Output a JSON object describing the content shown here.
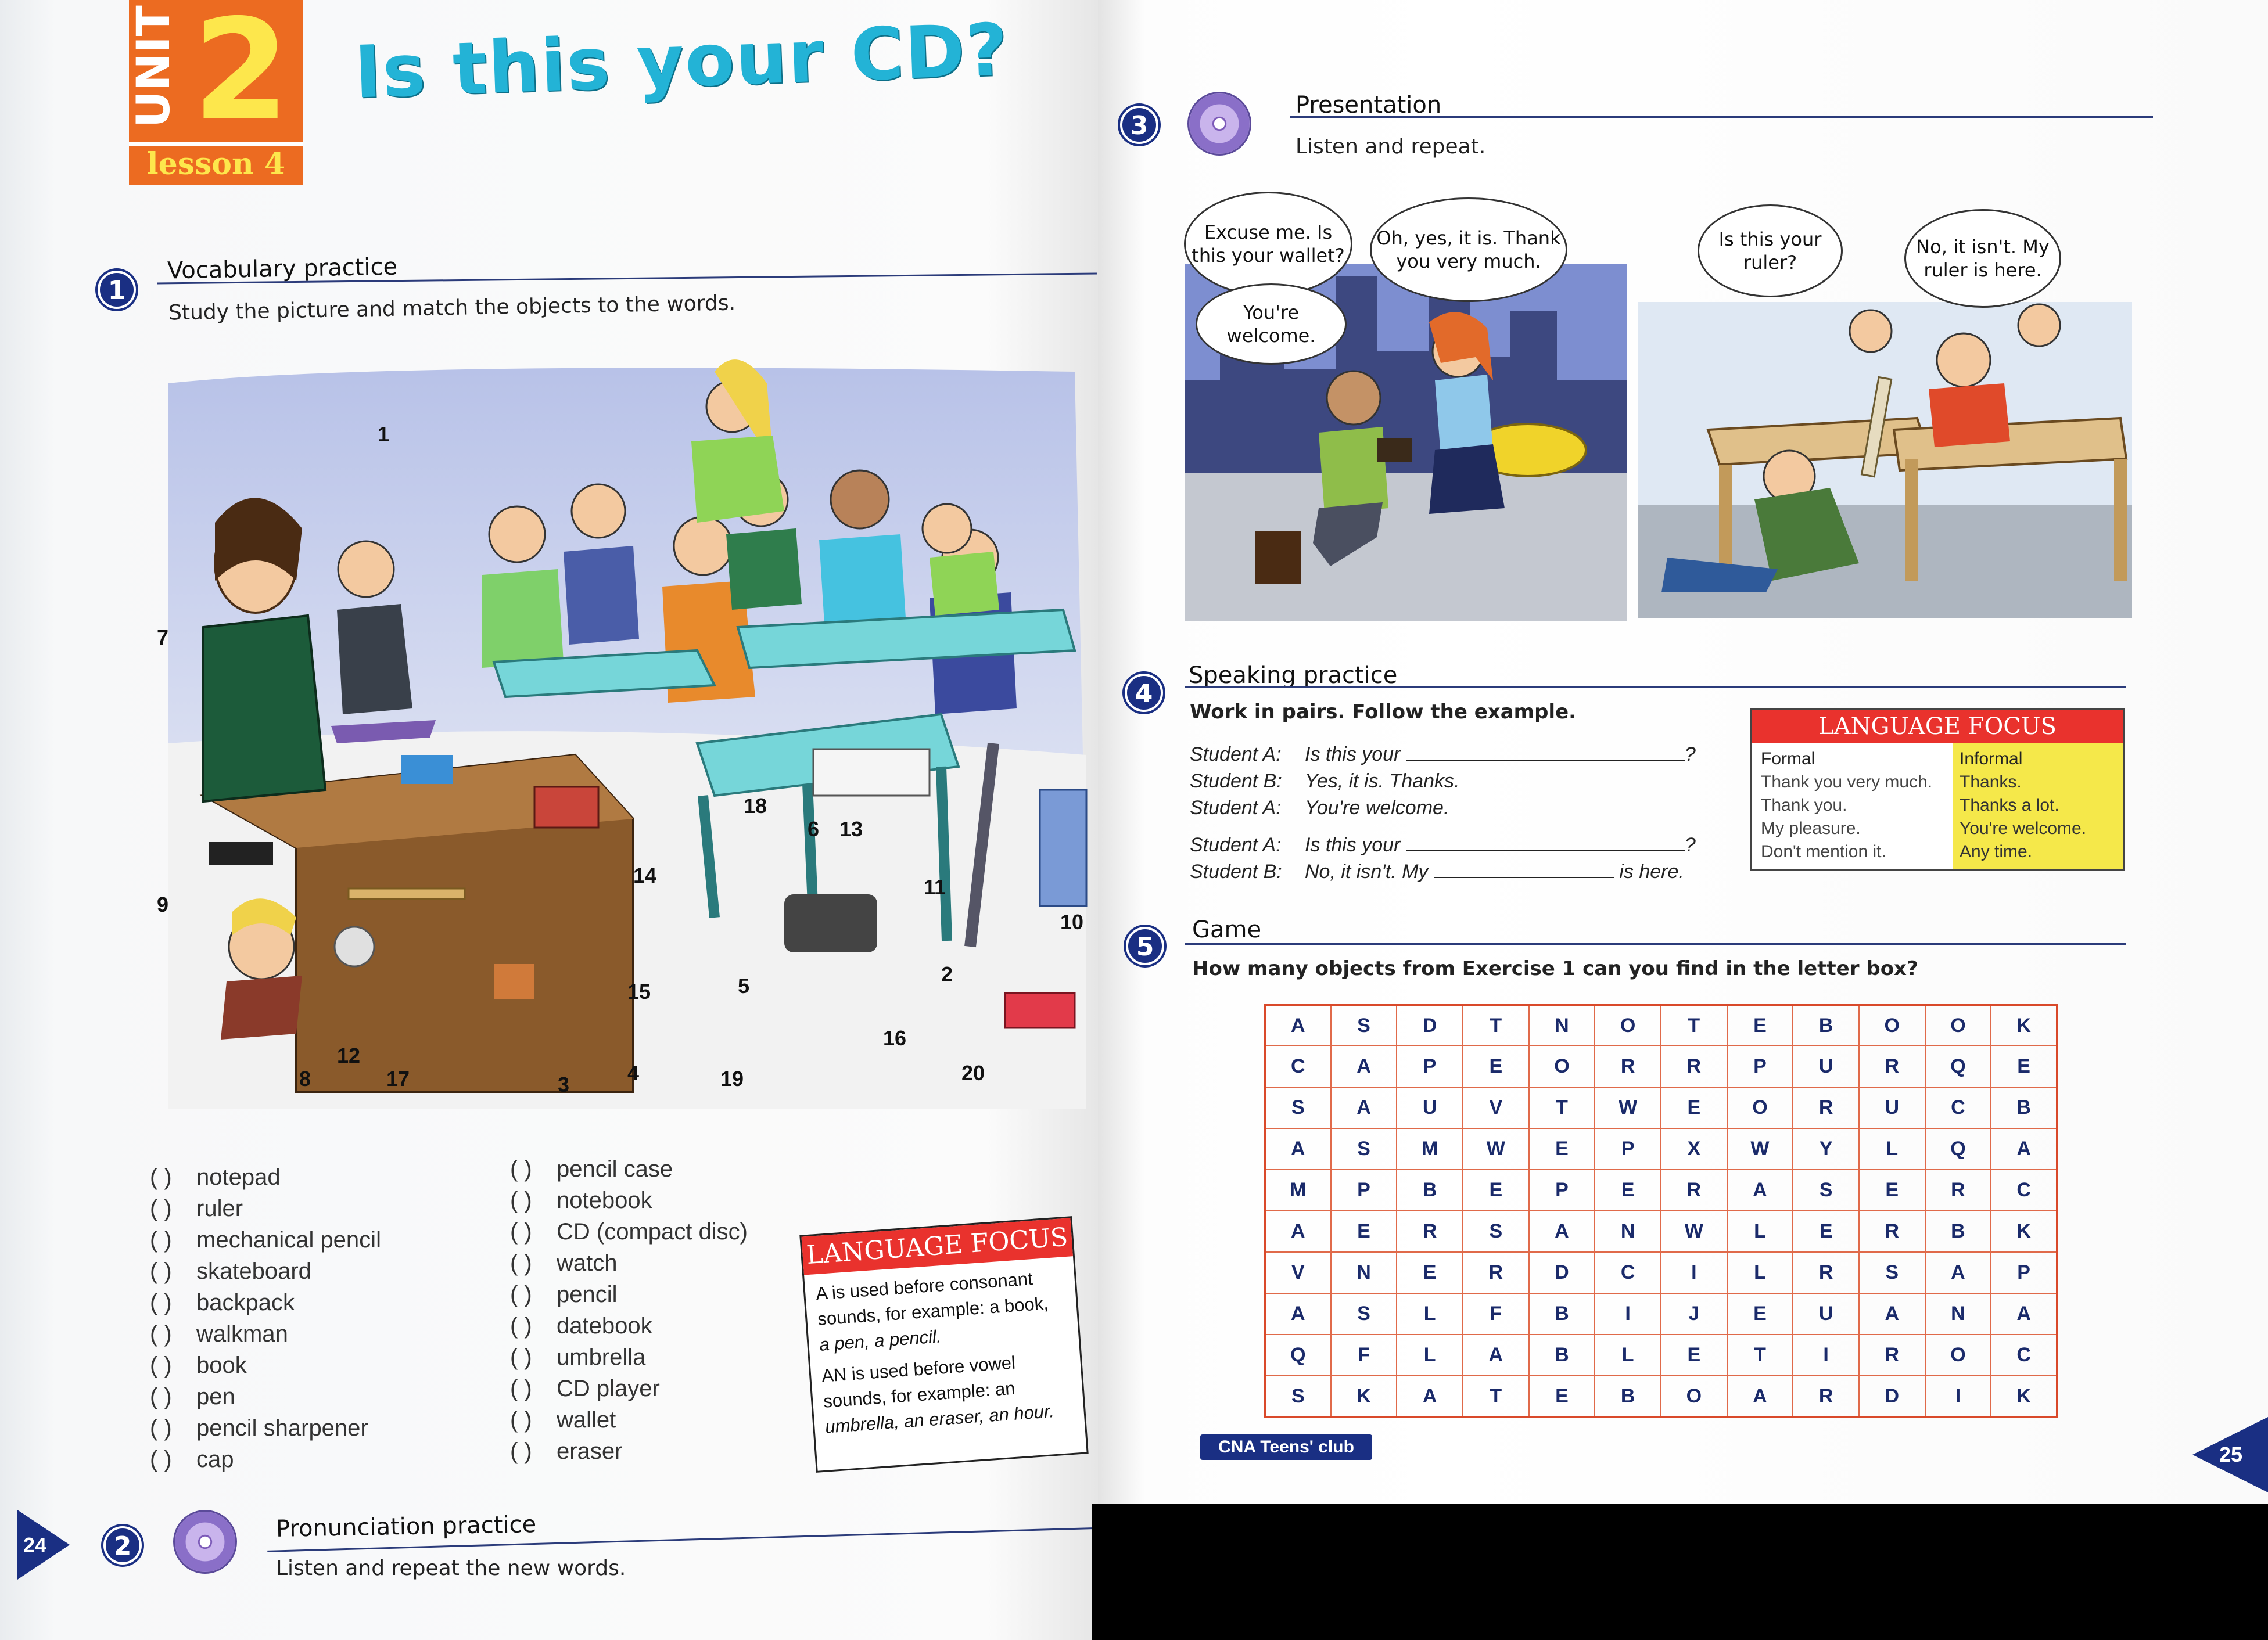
{
  "header": {
    "unit_word": "UNIT",
    "unit_number": "2",
    "lesson": "lesson 4",
    "title": "Is this your CD?"
  },
  "section1": {
    "number": "1",
    "title": "Vocabulary practice",
    "instruction": "Study the picture and match the objects to the words.",
    "picture_numbers": [
      "1",
      "2",
      "3",
      "4",
      "5",
      "6",
      "7",
      "8",
      "9",
      "10",
      "11",
      "12",
      "13",
      "14",
      "15",
      "16",
      "17",
      "18",
      "19",
      "20"
    ],
    "words_col1": [
      {
        "paren": "(     )",
        "word": "notepad"
      },
      {
        "paren": "(     )",
        "word": "ruler"
      },
      {
        "paren": "(     )",
        "word": "mechanical pencil"
      },
      {
        "paren": "(     )",
        "word": "skateboard"
      },
      {
        "paren": "(     )",
        "word": "backpack"
      },
      {
        "paren": "(     )",
        "word": "walkman"
      },
      {
        "paren": "(     )",
        "word": "book"
      },
      {
        "paren": "(     )",
        "word": "pen"
      },
      {
        "paren": "(     )",
        "word": "pencil sharpener"
      },
      {
        "paren": "(     )",
        "word": "cap"
      }
    ],
    "words_col2": [
      {
        "paren": "(     )",
        "word": "pencil case"
      },
      {
        "paren": "(     )",
        "word": "notebook"
      },
      {
        "paren": "(     )",
        "word": "CD (compact disc)"
      },
      {
        "paren": "(     )",
        "word": "watch"
      },
      {
        "paren": "(     )",
        "word": "pencil"
      },
      {
        "paren": "(     )",
        "word": "datebook"
      },
      {
        "paren": "(     )",
        "word": "umbrella"
      },
      {
        "paren": "(     )",
        "word": "CD player"
      },
      {
        "paren": "(     )",
        "word": "wallet"
      },
      {
        "paren": "(     )",
        "word": "eraser"
      }
    ]
  },
  "language_focus_1": {
    "heading": "LANGUAGE FOCUS",
    "line1_a": "A is used before consonant",
    "line1_b": "sounds, for example: a book,",
    "line1_c": "a pen, a pencil.",
    "line2_a": "AN is used before vowel",
    "line2_b": "sounds, for example: an",
    "line2_c": "umbrella, an eraser, an hour."
  },
  "section2": {
    "number": "2",
    "title": "Pronunciation practice",
    "instruction": "Listen and repeat the new words."
  },
  "section3": {
    "number": "3",
    "title": "Presentation",
    "instruction": "Listen and repeat.",
    "bubbles": {
      "b1": "Excuse me. Is this your wallet?",
      "b2": "Oh, yes, it is. Thank you very much.",
      "b3": "You're welcome.",
      "b4": "Is this your ruler?",
      "b5": "No, it isn't. My ruler is here."
    }
  },
  "section4": {
    "number": "4",
    "title": "Speaking practice",
    "instruction": "Work in pairs. Follow the example.",
    "lines": [
      {
        "speaker": "Student A:",
        "text": "Is this your",
        "end": "?"
      },
      {
        "speaker": "Student B:",
        "text": "Yes, it is. Thanks.",
        "end": ""
      },
      {
        "speaker": "Student A:",
        "text": "You're welcome.",
        "end": ""
      },
      {
        "speaker": "Student A:",
        "text": "Is this your",
        "end": "?"
      },
      {
        "speaker": "Student B:",
        "text": "No, it isn't. My",
        "end": "is here."
      }
    ]
  },
  "language_focus_2": {
    "heading": "LANGUAGE FOCUS",
    "formal_label": "Formal",
    "informal_label": "Informal",
    "formal": [
      "Thank you very much.",
      "Thank you.",
      "My pleasure.",
      "Don't mention it."
    ],
    "informal": [
      "Thanks.",
      "Thanks a lot.",
      "You're welcome.",
      "Any time."
    ]
  },
  "section5": {
    "number": "5",
    "title": "Game",
    "instruction": "How many objects from Exercise 1 can you find in the letter box?",
    "grid": [
      [
        "A",
        "S",
        "D",
        "T",
        "N",
        "O",
        "T",
        "E",
        "B",
        "O",
        "O",
        "K"
      ],
      [
        "C",
        "A",
        "P",
        "E",
        "O",
        "R",
        "R",
        "P",
        "U",
        "R",
        "Q",
        "E"
      ],
      [
        "S",
        "A",
        "U",
        "V",
        "T",
        "W",
        "E",
        "O",
        "R",
        "U",
        "C",
        "B"
      ],
      [
        "A",
        "S",
        "M",
        "W",
        "E",
        "P",
        "X",
        "W",
        "Y",
        "L",
        "Q",
        "A"
      ],
      [
        "M",
        "P",
        "B",
        "E",
        "P",
        "E",
        "R",
        "A",
        "S",
        "E",
        "R",
        "C"
      ],
      [
        "A",
        "E",
        "R",
        "S",
        "A",
        "N",
        "W",
        "L",
        "E",
        "R",
        "B",
        "K"
      ],
      [
        "V",
        "N",
        "E",
        "R",
        "D",
        "C",
        "I",
        "L",
        "R",
        "S",
        "A",
        "P"
      ],
      [
        "A",
        "S",
        "L",
        "F",
        "B",
        "I",
        "J",
        "E",
        "U",
        "A",
        "N",
        "A"
      ],
      [
        "Q",
        "F",
        "L",
        "A",
        "B",
        "L",
        "E",
        "T",
        "I",
        "R",
        "O",
        "C"
      ],
      [
        "S",
        "K",
        "A",
        "T",
        "E",
        "B",
        "O",
        "A",
        "R",
        "D",
        "I",
        "K"
      ]
    ]
  },
  "footer": {
    "page_left": "24",
    "page_right": "25",
    "logo": "CNA Teens' club"
  },
  "colors": {
    "unit_orange": "#ec6b21",
    "title_blue": "#23b3d6",
    "section_navy": "#1a2f83",
    "lf_red": "#e9322d",
    "informal_yellow": "#f5e84a",
    "grid_red": "#d9492a"
  }
}
